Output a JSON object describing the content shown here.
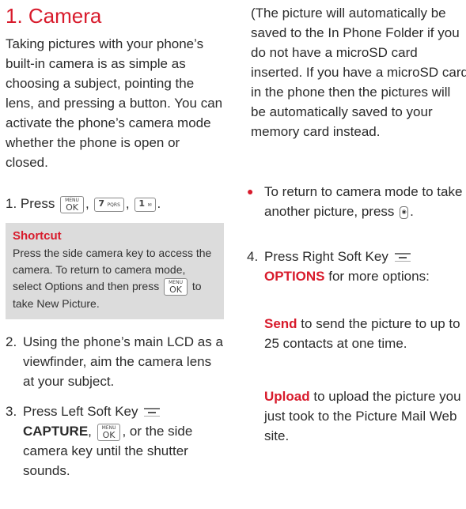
{
  "heading": "1. Camera",
  "intro": "Taking pictures with your phone’s built-in camera is as simple as choosing a subject, pointing the lens, and pressing a button. You can activate the phone’s camera mode whether the phone is open or closed.",
  "step1": {
    "prefix": "1. Press",
    "keys": [
      {
        "name": "menu-ok-key",
        "top": "MENU",
        "main": "OK"
      },
      {
        "name": "seven-key",
        "main": "7",
        "sub": "PQRS"
      },
      {
        "name": "one-key",
        "main": "1",
        "sub": "✉"
      }
    ]
  },
  "shortcut": {
    "title": "Shortcut",
    "body_before": "Press the side camera key to access the camera. To return to camera mode, select Options and then press",
    "body_after": "to take New Picture."
  },
  "step2": {
    "num": "2.",
    "text": "Using the phone’s main LCD as a viewfinder, aim the camera lens at your subject."
  },
  "step3": {
    "num": "3.",
    "text_before": "Press Left Soft Key",
    "capture": "CAPTURE",
    "text_middle": ", or the side camera key until the shutter sounds."
  },
  "note": "(The picture will automatically be saved to the In Phone Folder if you do not have a microSD card inserted. If you have a microSD card in the phone then the pictures will be automatically saved to your memory card instead.",
  "bullet": {
    "text": "To return to camera mode to take another picture, press"
  },
  "step4": {
    "num": "4.",
    "text_before": "Press Right Soft Key",
    "options": "OPTIONS",
    "text_after": "for more options:"
  },
  "send": {
    "label": "Send",
    "text": "to send the picture to up to 25 contacts at one time."
  },
  "upload": {
    "label": "Upload",
    "text": "to upload the picture you just took to the Picture Mail Web site."
  }
}
